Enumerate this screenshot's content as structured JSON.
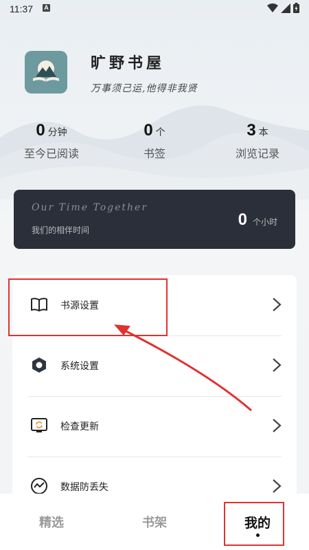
{
  "status_bar": {
    "time": "11:37",
    "notification_icon": "A"
  },
  "profile": {
    "app_name": "旷野书屋",
    "motto": "万事须己运,他得非我贤"
  },
  "stats": [
    {
      "value": "0",
      "unit": "分钟",
      "label": "至今已阅读"
    },
    {
      "value": "0",
      "unit": "个",
      "label": "书签"
    },
    {
      "value": "3",
      "unit": "本",
      "label": "浏览记录"
    }
  ],
  "together": {
    "title_en": "Our Time Together",
    "title_zh": "我们的相伴时间",
    "hours": "0",
    "unit": "个小时"
  },
  "menu": [
    {
      "label": "书源设置",
      "icon": "book-icon"
    },
    {
      "label": "系统设置",
      "icon": "settings-icon"
    },
    {
      "label": "检查更新",
      "icon": "update-icon"
    },
    {
      "label": "数据防丢失",
      "icon": "backup-icon"
    }
  ],
  "bottom_nav": [
    {
      "label": "精选",
      "active": false
    },
    {
      "label": "书架",
      "active": false
    },
    {
      "label": "我的",
      "active": true
    }
  ],
  "colors": {
    "highlight": "#e0312e",
    "card_dark": "#2b2f3a",
    "logo_bg": "#6d9a9f"
  }
}
